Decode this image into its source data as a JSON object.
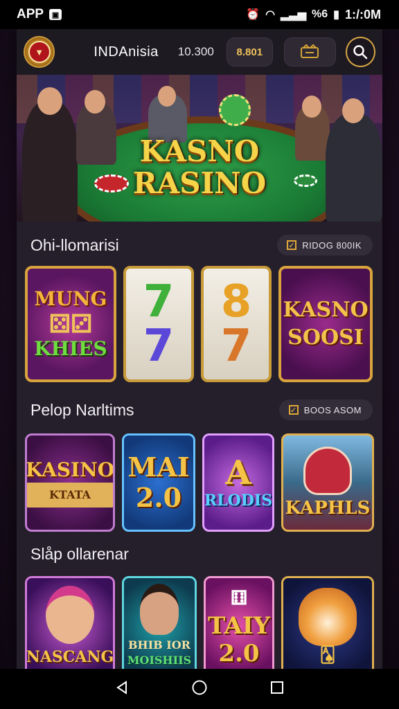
{
  "status_bar": {
    "left_label": "APP",
    "right_text": "%6",
    "time": "1:/:0M"
  },
  "header": {
    "brand": "INDAnisia",
    "balance": "10.300",
    "pill_value": "8.801"
  },
  "hero": {
    "title_line1": "KASNO",
    "title_line2": "RASINO"
  },
  "sections": [
    {
      "title": "Ohi-llomarisi",
      "tag": "RIDOG 800IK",
      "tiles": [
        {
          "label_top": "MUNG",
          "label_bottom": "KHIES"
        },
        {
          "reel_top": "7",
          "reel_bottom": "7"
        },
        {
          "reel_top": "8",
          "reel_bottom": "7"
        },
        {
          "label_top": "KASNO",
          "label_bottom": "SOOSI"
        }
      ]
    },
    {
      "title": "Pelop Narltims",
      "tag": "BOOS ASOM",
      "tiles": [
        {
          "label_top": "KASINO",
          "label_bottom": "KTATA"
        },
        {
          "label_top": "MAI",
          "label_bottom": "2.0"
        },
        {
          "label_top": "A",
          "label_bottom": "RLODIS"
        },
        {
          "label_top": "",
          "label_bottom": "KAPHLS"
        }
      ]
    },
    {
      "title": "Slåp ollarenar",
      "tiles": [
        {
          "label_top": "",
          "label_bottom": "NASCANG"
        },
        {
          "label_top": "BHIB IOR",
          "label_bottom": "MOISHIIS"
        },
        {
          "label_top": "TAIY",
          "label_bottom": "2.0"
        },
        {
          "label_top": "",
          "label_bottom": ""
        }
      ]
    }
  ],
  "colors": {
    "accent_gold": "#d9a33d",
    "background": "#241f2a"
  }
}
